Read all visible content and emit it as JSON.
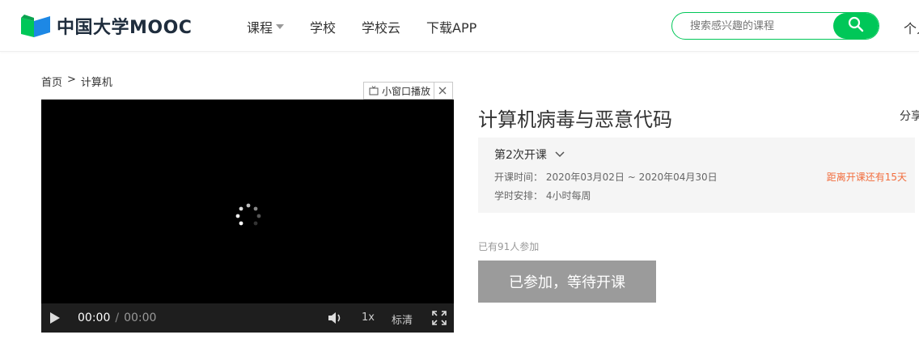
{
  "header": {
    "logo_text": "中国大学MOOC",
    "nav": [
      {
        "label": "课程",
        "has_caret": true
      },
      {
        "label": "学校",
        "has_caret": false
      },
      {
        "label": "学校云",
        "has_caret": false
      },
      {
        "label": "下载APP",
        "has_caret": false
      }
    ],
    "search_placeholder": "搜索感兴趣的课程",
    "personal_label": "个人"
  },
  "breadcrumb": {
    "home": "首页",
    "separator": ">",
    "current": "计算机"
  },
  "video": {
    "mini_player_label": "小窗口播放",
    "current_time": "00:00",
    "time_separator": "/",
    "duration": "00:00",
    "rate": "1x",
    "quality": "标清"
  },
  "course": {
    "title": "计算机病毒与恶意代码",
    "share_label": "分享",
    "term": "第2次开课",
    "start_time_label": "开课时间：",
    "start_time_value": "2020年03月02日 ~ 2020年04月30日",
    "schedule_label": "学时安排：",
    "schedule_value": "4小时每周",
    "countdown": "距离开课还有15天",
    "enrolled": "已有91人参加",
    "join_button": "已参加，等待开课"
  },
  "colors": {
    "brand_green": "#00c758",
    "countdown_orange": "#f26d3d",
    "join_button_gray": "#9b9b9b"
  }
}
